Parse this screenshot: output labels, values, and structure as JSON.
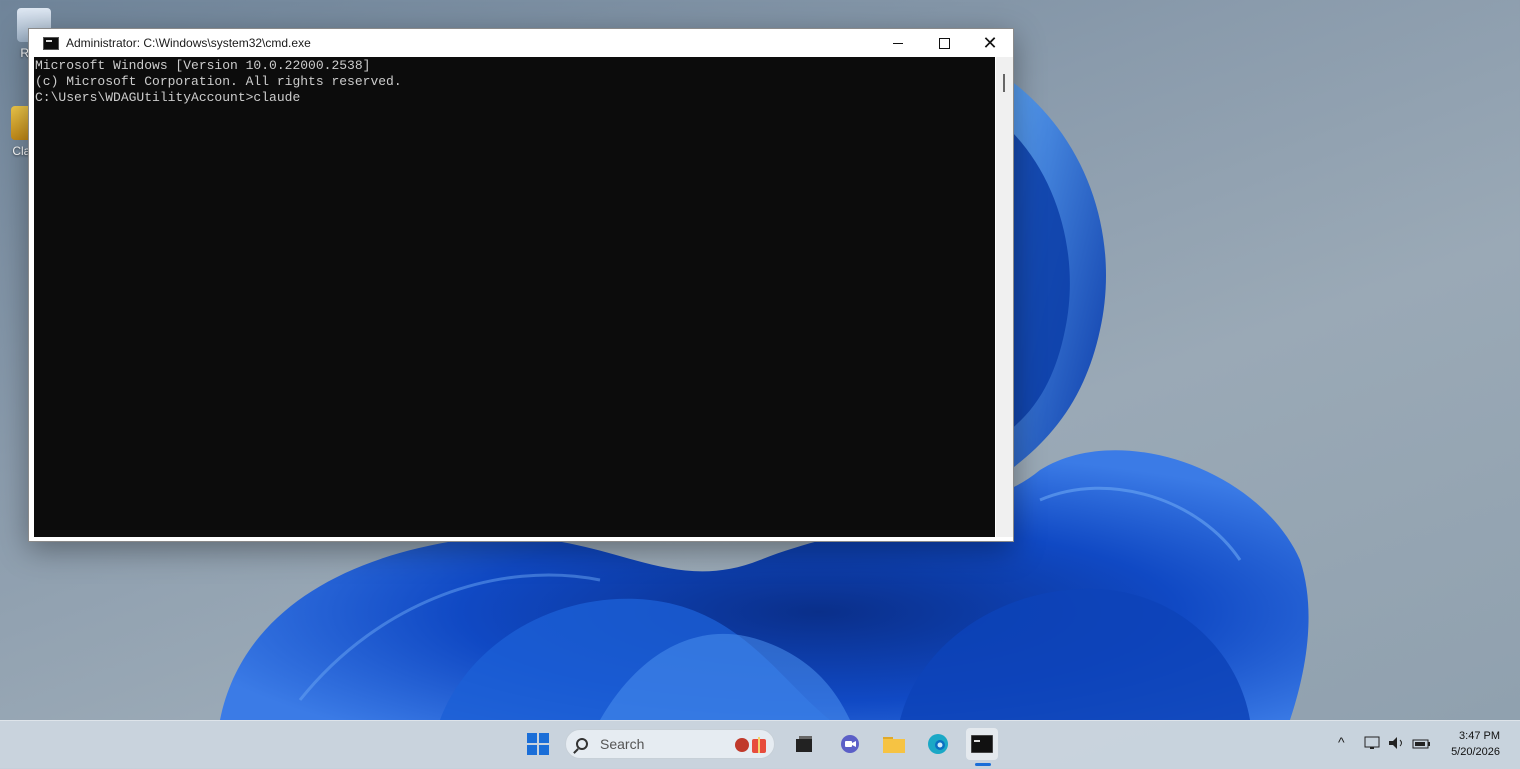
{
  "desktop": {
    "icons": [
      {
        "label": "Recy"
      },
      {
        "label": "Claud"
      }
    ]
  },
  "window": {
    "title": "Administrator: C:\\Windows\\system32\\cmd.exe",
    "minimize_glyph": "",
    "close_glyph": "✕"
  },
  "console": {
    "lines": [
      "Microsoft Windows [Version 10.0.22000.2538]",
      "(c) Microsoft Corporation. All rights reserved.",
      "",
      "C:\\Users\\WDAGUtilityAccount>claude"
    ]
  },
  "taskbar": {
    "search_label": "Search",
    "tray_chevron": "^",
    "time": "3:47 PM",
    "date": "5/20/2026"
  },
  "colors": {
    "console_bg": "#0c0c0c",
    "console_fg": "#cccccc",
    "accent": "#1a6ed8"
  }
}
